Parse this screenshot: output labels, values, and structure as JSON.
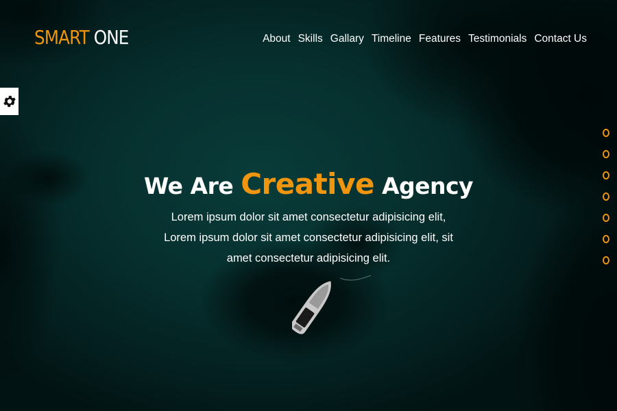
{
  "colors": {
    "accent": "#f0950f",
    "text": "#ffffff",
    "background": "#062a2a"
  },
  "brand": {
    "part1": "SMART",
    "part2": "ONE"
  },
  "nav": {
    "items": [
      {
        "label": "About"
      },
      {
        "label": "Skills"
      },
      {
        "label": "Gallary"
      },
      {
        "label": "Timeline"
      },
      {
        "label": "Features"
      },
      {
        "label": "Testimonials"
      },
      {
        "label": "Contact Us"
      }
    ]
  },
  "settings": {
    "icon": "gear-icon"
  },
  "hero": {
    "title_before": "We Are",
    "title_accent": "Creative",
    "title_after": "Agency",
    "text": "Lorem ipsum dolor sit amet consectetur adipisicing elit, Lorem ipsum dolor sit amet consectetur adipisicing elit, sit amet consectetur adipisicing elit."
  },
  "slider": {
    "bullet_count": 7,
    "active_index": null
  }
}
